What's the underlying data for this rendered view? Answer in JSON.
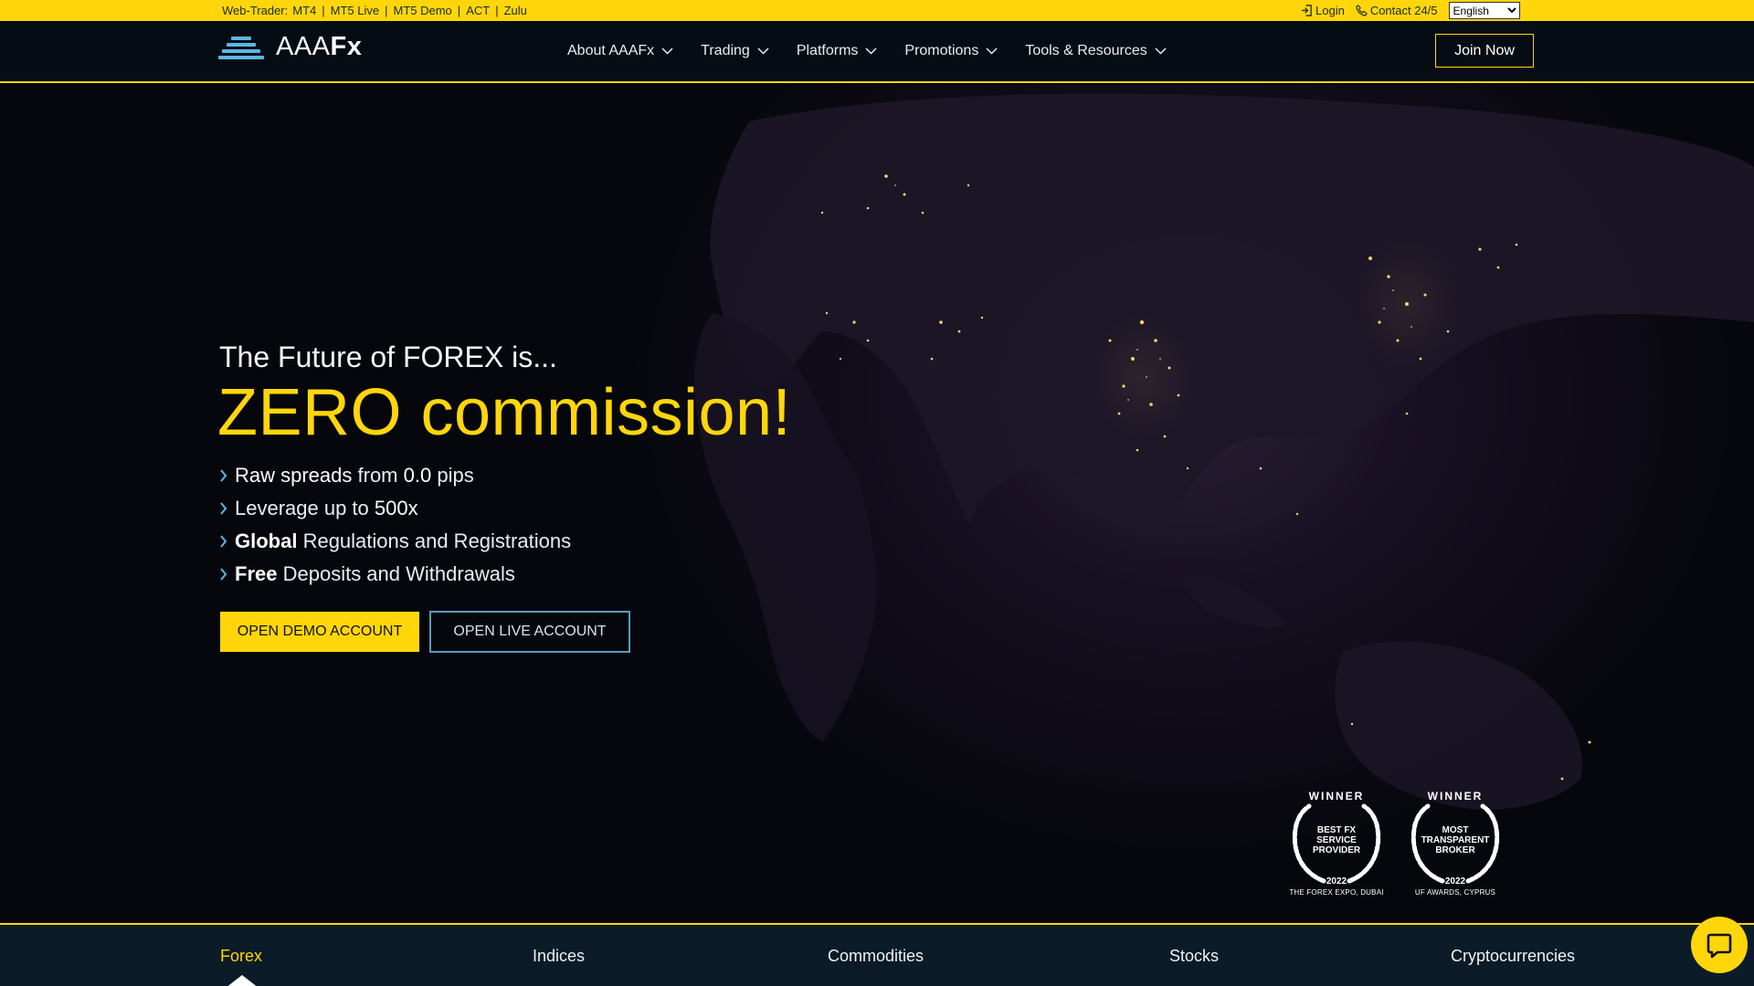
{
  "topbar": {
    "webtrader_label": "Web-Trader:",
    "webtrader_links": [
      "MT4",
      "MT5 Live",
      "MT5 Demo",
      "ACT",
      "Zulu"
    ],
    "login_label": "Login",
    "contact_label": "Contact 24/5",
    "language": "English"
  },
  "nav": {
    "logo_text_light": "AAA",
    "logo_text_bold": "Fx",
    "menu": [
      {
        "label": "About AAAFx"
      },
      {
        "label": "Trading"
      },
      {
        "label": "Platforms"
      },
      {
        "label": "Promotions"
      },
      {
        "label": "Tools & Resources"
      }
    ],
    "join_label": "Join Now"
  },
  "hero": {
    "subtitle": "The Future of FOREX is...",
    "headline": "ZERO commission!",
    "bullets": [
      {
        "strong": "Raw spreads",
        "text1": " from ",
        "strong2": "0.0",
        "text2": " pips"
      },
      {
        "text1": "Leverage up to ",
        "strong2": "500x"
      },
      {
        "strong": "Global",
        "text1": " Regulations and Registrations"
      },
      {
        "strong": "Free",
        "text1": " Deposits and Withdrawals"
      }
    ],
    "demo_button": "OPEN DEMO ACCOUNT",
    "live_button": "OPEN LIVE ACCOUNT"
  },
  "awards": [
    {
      "winner": "WINNER",
      "title": "BEST FX SERVICE PROVIDER",
      "year": "2022",
      "location": "THE FOREX EXPO, DUBAI"
    },
    {
      "winner": "WINNER",
      "title": "MOST TRANSPARENT BROKER",
      "year": "2022",
      "location": "UF AWARDS, CYPRUS"
    }
  ],
  "tabs": [
    {
      "label": "Forex",
      "active": true
    },
    {
      "label": "Indices",
      "active": false
    },
    {
      "label": "Commodities",
      "active": false
    },
    {
      "label": "Stocks",
      "active": false
    },
    {
      "label": "Cryptocurrencies",
      "active": false
    }
  ],
  "colors": {
    "accent": "#ffd60a",
    "nav_bg": "#070e16",
    "tab_bar_bg": "#0b1b28",
    "outline_blue": "#5a9cc2"
  },
  "icons": {
    "login": "login-icon",
    "contact": "phone-icon",
    "chat": "chat-icon"
  }
}
